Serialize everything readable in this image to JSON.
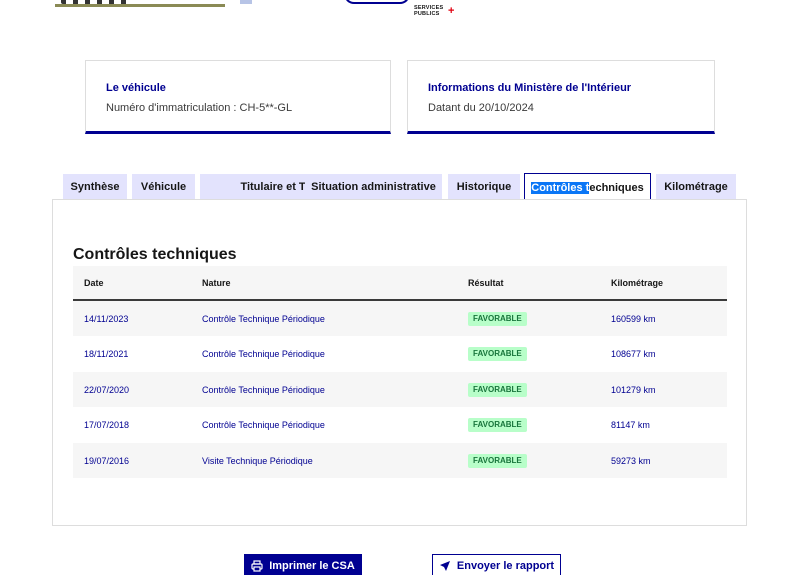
{
  "header": {
    "services_publics_line1": "SERVICES",
    "services_publics_line2": "PUBLICS",
    "services_publics_plus": "+"
  },
  "cards": {
    "vehicle": {
      "title": "Le véhicule",
      "text": "Numéro d'immatriculation : CH-5**-GL"
    },
    "ministere": {
      "title": "Informations du Ministère de l'Intérieur",
      "text": "Datant du 20/10/2024"
    }
  },
  "tabs": [
    {
      "label": "Synthèse"
    },
    {
      "label": "Véhicule"
    },
    {
      "label": "Titulaire et Titre"
    },
    {
      "label": "Situation administrative"
    },
    {
      "label": "Historique"
    },
    {
      "label_highlight": "Contrôles t",
      "label_rest": "echniques"
    },
    {
      "label": "Kilométrage"
    }
  ],
  "section": {
    "title": "Contrôles techniques",
    "columns": {
      "date": "Date",
      "nature": "Nature",
      "result": "Résultat",
      "km": "Kilométrage"
    },
    "rows": [
      {
        "date": "14/11/2023",
        "nature": "Contrôle Technique Périodique",
        "result": "FAVORABLE",
        "km": "160599 km"
      },
      {
        "date": "18/11/2021",
        "nature": "Contrôle Technique Périodique",
        "result": "FAVORABLE",
        "km": "108677 km"
      },
      {
        "date": "22/07/2020",
        "nature": "Contrôle Technique Périodique",
        "result": "FAVORABLE",
        "km": "101279 km"
      },
      {
        "date": "17/07/2018",
        "nature": "Contrôle Technique Périodique",
        "result": "FAVORABLE",
        "km": "81147 km"
      },
      {
        "date": "19/07/2016",
        "nature": "Visite Technique Périodique",
        "result": "FAVORABLE",
        "km": "59273 km"
      }
    ]
  },
  "actions": {
    "print_label": "Imprimer le CSA",
    "send_label": "Envoyer le rapport"
  },
  "colors": {
    "primary": "#000091",
    "tab_bg": "#e3e3fd",
    "badge_bg": "#b8fec9",
    "badge_text": "#18753c",
    "selection": "#0a76f6"
  }
}
